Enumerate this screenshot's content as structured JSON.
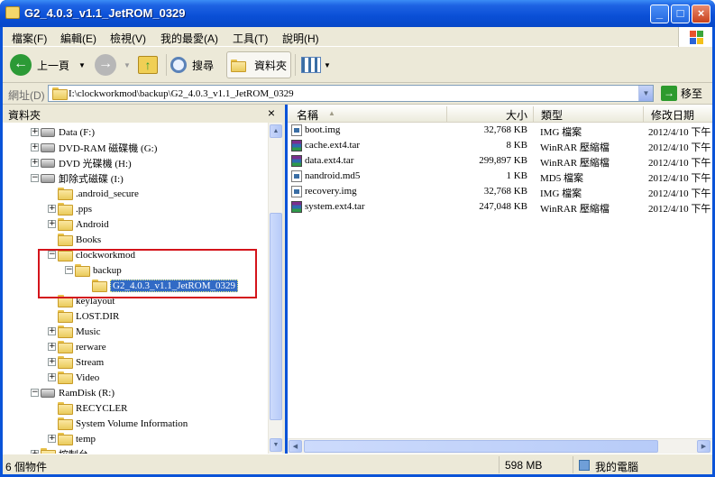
{
  "window": {
    "title": "G2_4.0.3_v1.1_JetROM_0329"
  },
  "menu": {
    "items": [
      "檔案(F)",
      "編輯(E)",
      "檢視(V)",
      "我的最愛(A)",
      "工具(T)",
      "說明(H)"
    ]
  },
  "toolbar": {
    "back_label": "上一頁",
    "search_label": "搜尋",
    "folders_label": "資料夾"
  },
  "address": {
    "label": "網址(D)",
    "value": "I:\\clockworkmod\\backup\\G2_4.0.3_v1.1_JetROM_0329",
    "go_label": "移至"
  },
  "folder_pane": {
    "title": "資料夾",
    "close_glyph": "×",
    "tree": [
      {
        "label": "Data (F:)",
        "level": 0,
        "expander": "+",
        "kind": "drive"
      },
      {
        "label": "DVD-RAM 磁碟機 (G:)",
        "level": 0,
        "expander": "+",
        "kind": "drive"
      },
      {
        "label": "DVD 光碟機 (H:)",
        "level": 0,
        "expander": "+",
        "kind": "drive"
      },
      {
        "label": "卸除式磁碟 (I:)",
        "level": 0,
        "expander": "−",
        "kind": "drive"
      },
      {
        "label": ".android_secure",
        "level": 1,
        "expander": "",
        "kind": "folder"
      },
      {
        "label": ".pps",
        "level": 1,
        "expander": "+",
        "kind": "folder"
      },
      {
        "label": "Android",
        "level": 1,
        "expander": "+",
        "kind": "folder"
      },
      {
        "label": "Books",
        "level": 1,
        "expander": "",
        "kind": "folder"
      },
      {
        "label": "clockworkmod",
        "level": 1,
        "expander": "−",
        "kind": "folder"
      },
      {
        "label": "backup",
        "level": 2,
        "expander": "−",
        "kind": "folder"
      },
      {
        "label": "G2_4.0.3_v1.1_JetROM_0329",
        "level": 3,
        "expander": "",
        "kind": "folder",
        "selected": true
      },
      {
        "label": "keylayout",
        "level": 1,
        "expander": "",
        "kind": "folder"
      },
      {
        "label": "LOST.DIR",
        "level": 1,
        "expander": "",
        "kind": "folder"
      },
      {
        "label": "Music",
        "level": 1,
        "expander": "+",
        "kind": "folder"
      },
      {
        "label": "rerware",
        "level": 1,
        "expander": "+",
        "kind": "folder"
      },
      {
        "label": "Stream",
        "level": 1,
        "expander": "+",
        "kind": "folder"
      },
      {
        "label": "Video",
        "level": 1,
        "expander": "+",
        "kind": "folder"
      },
      {
        "label": "RamDisk (R:)",
        "level": 0,
        "expander": "−",
        "kind": "drive"
      },
      {
        "label": "RECYCLER",
        "level": 1,
        "expander": "",
        "kind": "folder"
      },
      {
        "label": "System Volume Information",
        "level": 1,
        "expander": "",
        "kind": "folder"
      },
      {
        "label": "temp",
        "level": 1,
        "expander": "+",
        "kind": "folder"
      },
      {
        "label": "控制台",
        "level": 0,
        "expander": "+",
        "kind": "folder"
      }
    ]
  },
  "file_list": {
    "columns": [
      "名稱",
      "大小",
      "類型",
      "修改日期"
    ],
    "sort_indicator": "▲",
    "rows": [
      {
        "name": "boot.img",
        "size": "32,768 KB",
        "type": "IMG 檔案",
        "date": "2012/4/10 下午",
        "icon": "img"
      },
      {
        "name": "cache.ext4.tar",
        "size": "8 KB",
        "type": "WinRAR 壓縮檔",
        "date": "2012/4/10 下午",
        "icon": "rar"
      },
      {
        "name": "data.ext4.tar",
        "size": "299,897 KB",
        "type": "WinRAR 壓縮檔",
        "date": "2012/4/10 下午",
        "icon": "rar"
      },
      {
        "name": "nandroid.md5",
        "size": "1 KB",
        "type": "MD5 檔案",
        "date": "2012/4/10 下午",
        "icon": "img"
      },
      {
        "name": "recovery.img",
        "size": "32,768 KB",
        "type": "IMG 檔案",
        "date": "2012/4/10 下午",
        "icon": "img"
      },
      {
        "name": "system.ext4.tar",
        "size": "247,048 KB",
        "type": "WinRAR 壓縮檔",
        "date": "2012/4/10 下午",
        "icon": "rar"
      }
    ]
  },
  "status": {
    "count": "6 個物件",
    "size": "598 MB",
    "location": "我的電腦"
  }
}
